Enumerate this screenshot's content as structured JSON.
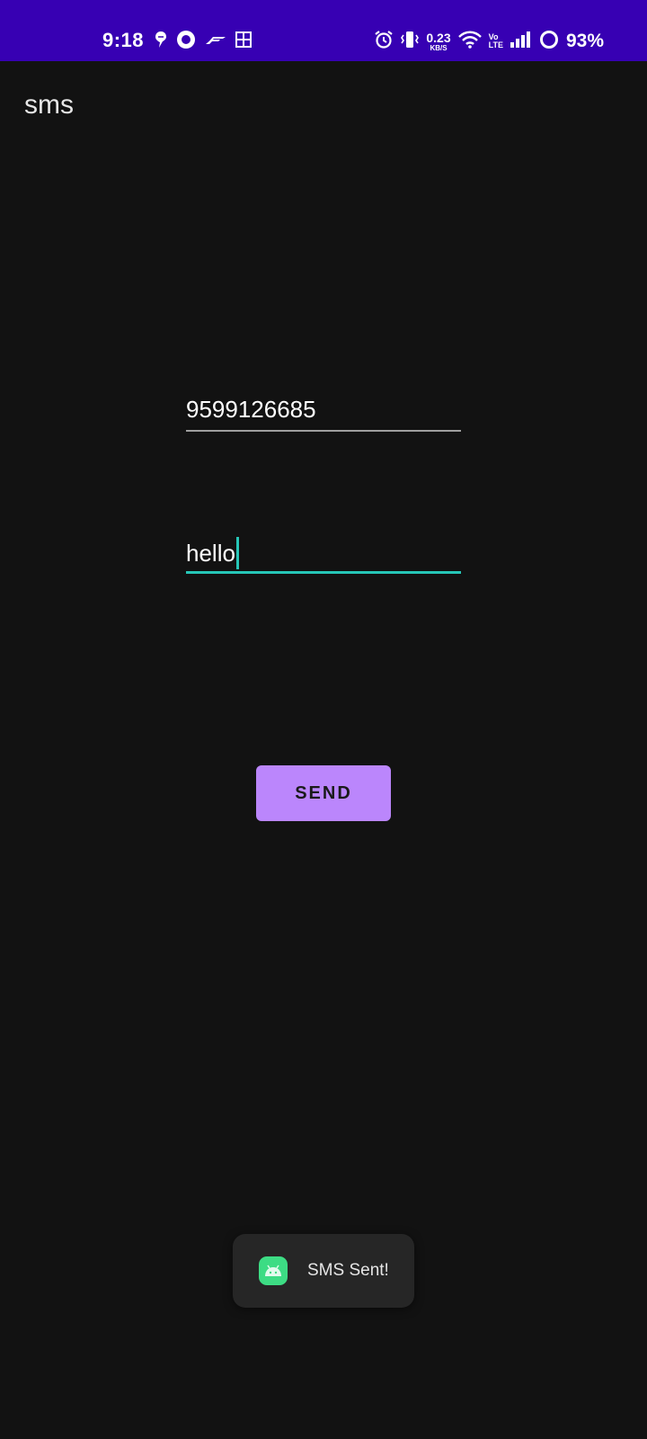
{
  "status_bar": {
    "time": "9:18",
    "network_speed_value": "0.23",
    "network_speed_unit": "KB/S",
    "volte_top": "Vo",
    "volte_bottom": "LTE",
    "battery_percent": "93%",
    "background_color": "#3700b3",
    "left_icons": [
      "swiggy-icon",
      "circle-app-icon",
      "f1-icon",
      "uniqlo-icon"
    ],
    "right_icons": [
      "alarm-icon",
      "vibrate-icon",
      "wifi-icon",
      "volte-icon",
      "signal-icon",
      "battery-ring-icon"
    ]
  },
  "app_bar": {
    "title": "sms"
  },
  "form": {
    "phone_value": "9599126685",
    "message_value": "hello",
    "send_label": "SEND",
    "accent_color": "#26c6b7",
    "button_color": "#bb86fc"
  },
  "toast": {
    "text": "SMS Sent!",
    "icon": "android-icon"
  }
}
